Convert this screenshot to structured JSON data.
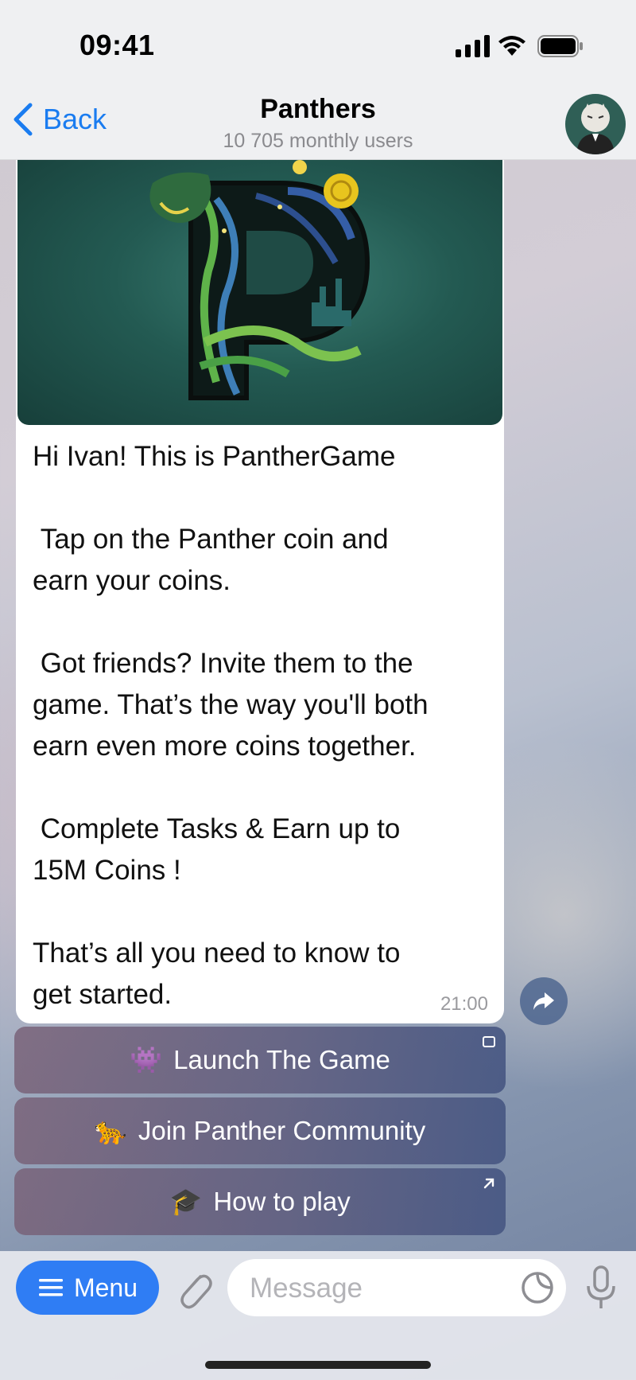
{
  "status_bar": {
    "time": "09:41"
  },
  "header": {
    "back_label": "Back",
    "title": "Panthers",
    "subtitle": "10 705 monthly users"
  },
  "message": {
    "text": "Hi Ivan! This is PantherGame\n\n Tap on the Panther coin and\nearn your coins.\n\n Got friends? Invite them to the\ngame. That’s the way you'll both\nearn even more coins together.\n\n Complete Tasks & Earn up to\n15M Coins !\n\nThat’s all you need to know to\nget started.",
    "time": "21:00"
  },
  "buttons": [
    {
      "emoji": "👾",
      "label": "Launch The Game",
      "corner": "webapp-icon"
    },
    {
      "emoji": "🐆",
      "label": "Join Panther Community",
      "corner": ""
    },
    {
      "emoji": "🎓",
      "label": "How to play",
      "corner": "external-link-icon"
    }
  ],
  "input_bar": {
    "menu_label": "Menu",
    "placeholder": "Message"
  },
  "colors": {
    "accent": "#2f7df4",
    "link": "#1a7cf0"
  }
}
